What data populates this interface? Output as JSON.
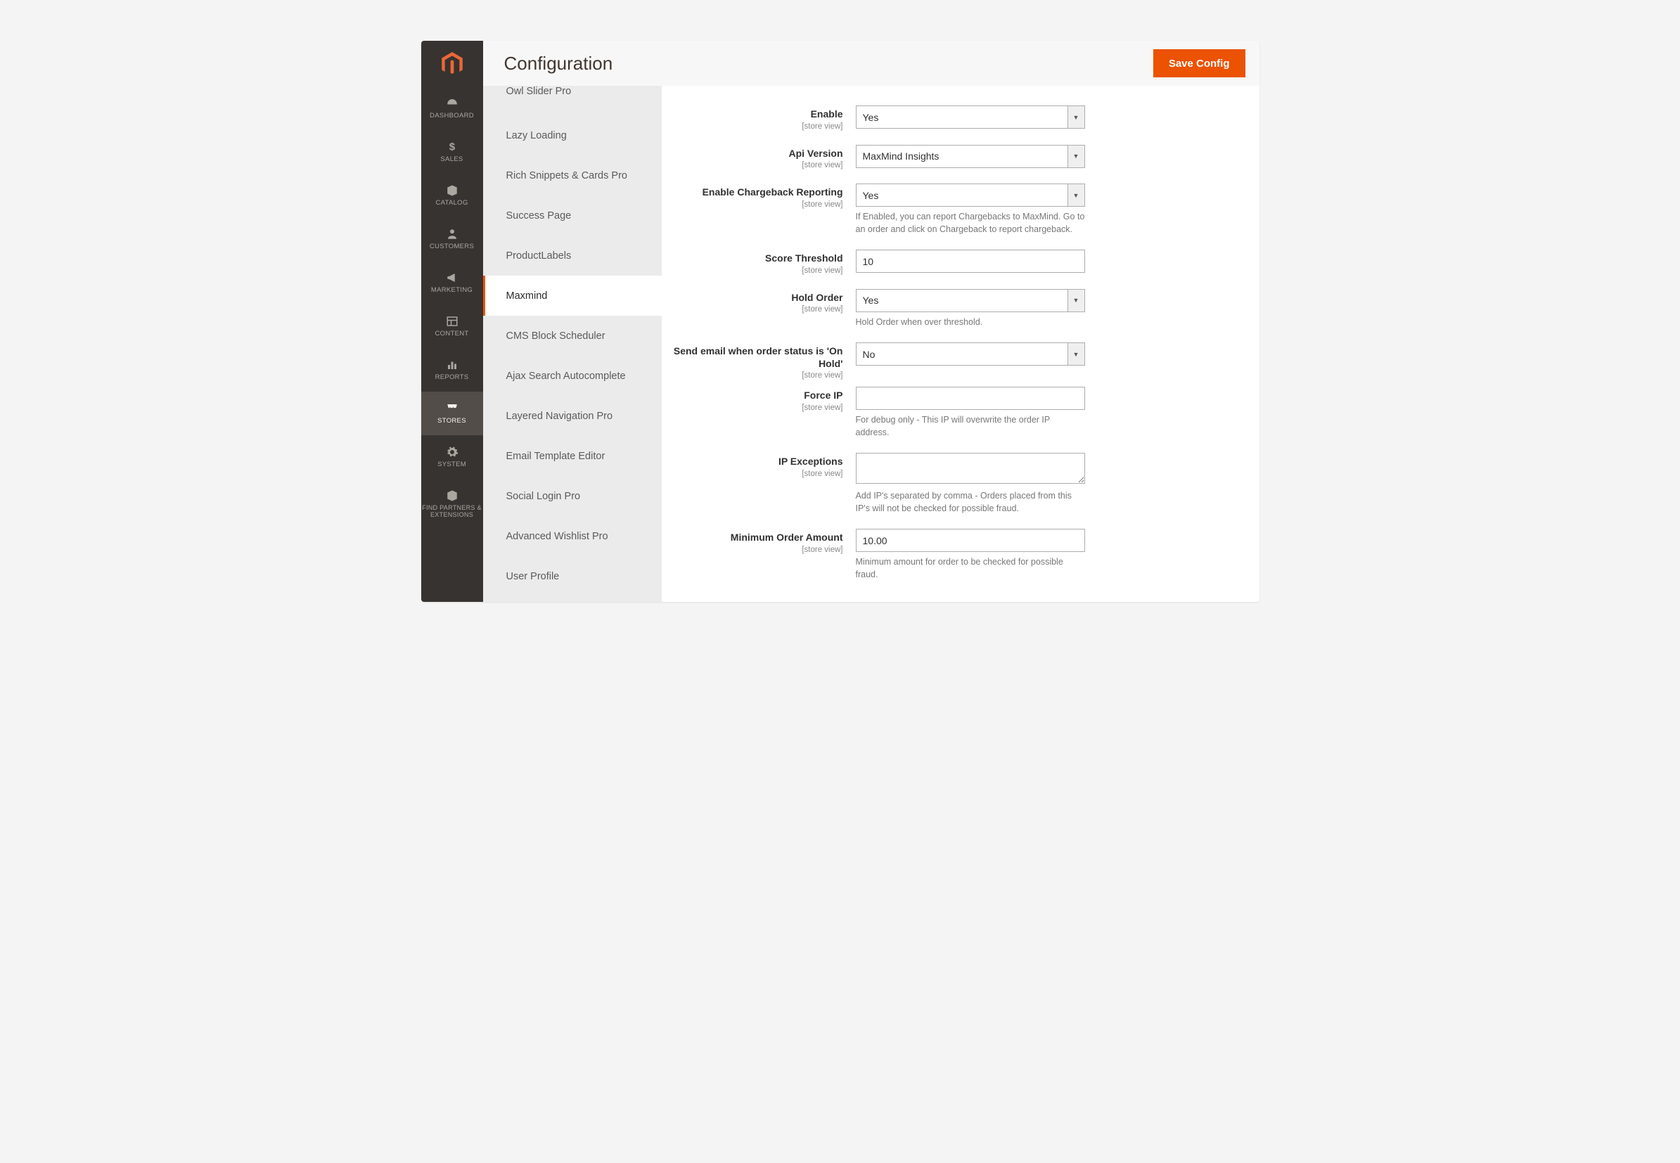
{
  "page": {
    "title": "Configuration",
    "save": "Save Config"
  },
  "nav": {
    "items": [
      {
        "label": "DASHBOARD"
      },
      {
        "label": "SALES"
      },
      {
        "label": "CATALOG"
      },
      {
        "label": "CUSTOMERS"
      },
      {
        "label": "MARKETING"
      },
      {
        "label": "CONTENT"
      },
      {
        "label": "REPORTS"
      },
      {
        "label": "STORES",
        "active": true
      },
      {
        "label": "SYSTEM"
      },
      {
        "label": "FIND PARTNERS & EXTENSIONS"
      }
    ]
  },
  "sections": [
    "Owl Slider Pro",
    "Lazy Loading",
    "Rich Snippets & Cards Pro",
    "Success Page",
    "ProductLabels",
    "Maxmind",
    "CMS Block Scheduler",
    "Ajax Search Autocomplete",
    "Layered Navigation Pro",
    "Email Template Editor",
    "Social Login Pro",
    "Advanced Wishlist Pro",
    "User Profile"
  ],
  "scope": "[store view]",
  "form": {
    "enable": {
      "label": "Enable",
      "value": "Yes"
    },
    "api_version": {
      "label": "Api Version",
      "value": "MaxMind Insights"
    },
    "enable_cb": {
      "label": "Enable Chargeback Reporting",
      "value": "Yes",
      "help": "If Enabled, you can report Chargebacks to MaxMind. Go to an order and click on Chargeback to report chargeback."
    },
    "score_threshold": {
      "label": "Score Threshold",
      "value": "10"
    },
    "hold_order": {
      "label": "Hold Order",
      "value": "Yes",
      "help": "Hold Order when over threshold."
    },
    "send_email": {
      "label": "Send email when order status is 'On Hold'",
      "value": "No"
    },
    "force_ip": {
      "label": "Force IP",
      "value": "",
      "help": "For debug only - This IP will overwrite the order IP address."
    },
    "ip_exceptions": {
      "label": "IP Exceptions",
      "value": "",
      "help": "Add IP's separated by comma - Orders placed from this IP's will not be checked for possible fraud."
    },
    "min_order": {
      "label": "Minimum Order Amount",
      "value": "10.00",
      "help": "Minimum amount for order to be checked for possible fraud."
    }
  }
}
